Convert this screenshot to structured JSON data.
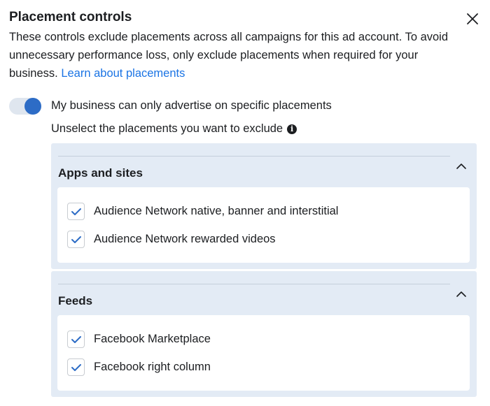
{
  "dialog": {
    "title": "Placement controls",
    "description": "These controls exclude placements across all campaigns for this ad account. To avoid unnecessary performance loss, only exclude placements when required for your business.",
    "link_text": "Learn about placements",
    "close_icon": "close-icon"
  },
  "toggle": {
    "label": "My business can only advertise on specific placements",
    "on": true
  },
  "hint": {
    "text": "Unselect the placements you want to exclude",
    "icon": "info-icon"
  },
  "sections": [
    {
      "title": "Apps and sites",
      "expanded": true,
      "items": [
        {
          "label": "Audience Network native, banner and interstitial",
          "checked": true
        },
        {
          "label": "Audience Network rewarded videos",
          "checked": true
        }
      ]
    },
    {
      "title": "Feeds",
      "expanded": true,
      "items": [
        {
          "label": "Facebook Marketplace",
          "checked": true
        },
        {
          "label": "Facebook right column",
          "checked": true
        }
      ]
    }
  ],
  "colors": {
    "accent": "#2d6cc6",
    "link": "#1b74e4",
    "section_bg": "#e3ebf5"
  }
}
